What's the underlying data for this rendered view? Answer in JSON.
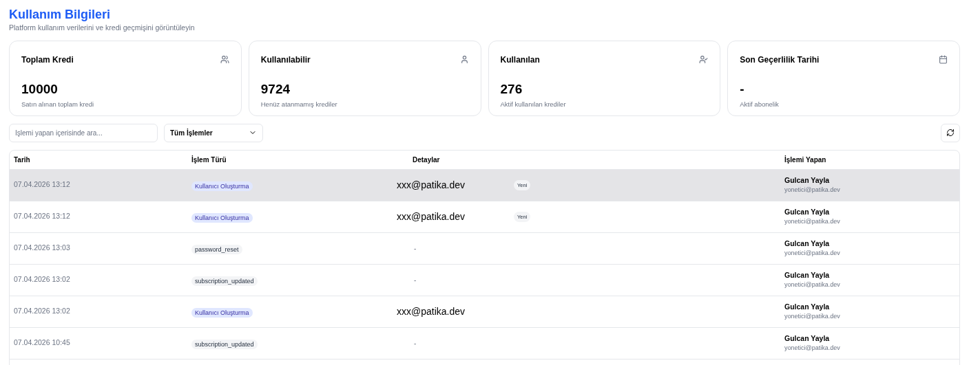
{
  "header": {
    "title": "Kullanım Bilgileri",
    "subtitle": "Platform kullanım verilerini ve kredi geçmişini görüntüleyin"
  },
  "stats": [
    {
      "label": "Toplam Kredi",
      "value": "10000",
      "caption": "Satın alınan toplam kredi",
      "kind": "users"
    },
    {
      "label": "Kullanılabilir",
      "value": "9724",
      "caption": "Henüz atanmamış krediler",
      "kind": "user"
    },
    {
      "label": "Kullanılan",
      "value": "276",
      "caption": "Aktif kullanılan krediler",
      "kind": "user-check"
    },
    {
      "label": "Son Geçerlilik Tarihi",
      "value": "-",
      "caption": "Aktif abonelik",
      "kind": "calendar"
    }
  ],
  "filters": {
    "search": {
      "placeholder": "İşlemi yapan içerisinde ara..."
    },
    "type_select": {
      "value": "Tüm İşlemler"
    }
  },
  "table": {
    "columns": [
      "Tarih",
      "İşlem Türü",
      "Detaylar",
      "İşlemi Yapan"
    ],
    "rows": [
      {
        "date": "07.04.2026 13:12",
        "type": {
          "label": "Kullanıcı Oluşturma",
          "kind": "create"
        },
        "detail": "xxx@patika.dev",
        "badge": "Yeni",
        "user": "Gulcan Yayla",
        "user_email": "yonetici@patika.dev",
        "highlighted": true
      },
      {
        "date": "07.04.2026 13:12",
        "type": {
          "label": "Kullanıcı Oluşturma",
          "kind": "create"
        },
        "detail": "xxx@patika.dev",
        "badge": "Yeni",
        "user": "Gulcan Yayla",
        "user_email": "yonetici@patika.dev",
        "highlighted": false
      },
      {
        "date": "07.04.2026 13:03",
        "type": {
          "label": "password_reset",
          "kind": "system"
        },
        "detail": "-",
        "user": "Gulcan Yayla",
        "user_email": "yonetici@patika.dev",
        "highlighted": false
      },
      {
        "date": "07.04.2026 13:02",
        "type": {
          "label": "subscription_updated",
          "kind": "system"
        },
        "detail": "-",
        "user": "Gulcan Yayla",
        "user_email": "yonetici@patika.dev",
        "highlighted": false
      },
      {
        "date": "07.04.2026 13:02",
        "type": {
          "label": "Kullanıcı Oluşturma",
          "kind": "create"
        },
        "detail": "xxx@patika.dev",
        "user": "Gulcan Yayla",
        "user_email": "yonetici@patika.dev",
        "highlighted": false
      },
      {
        "date": "07.04.2026 10:45",
        "type": {
          "label": "subscription_updated",
          "kind": "system"
        },
        "detail": "-",
        "user": "Gulcan Yayla",
        "user_email": "yonetici@patika.dev",
        "highlighted": false
      }
    ]
  }
}
